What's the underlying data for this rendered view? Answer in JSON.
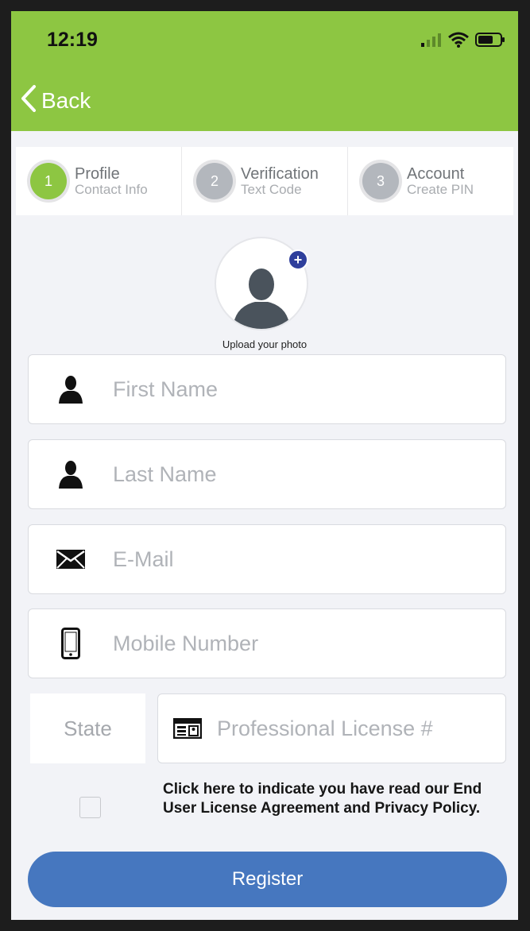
{
  "status_bar": {
    "time": "12:19"
  },
  "nav": {
    "back_label": "Back"
  },
  "stepper": [
    {
      "number": "1",
      "title": "Profile",
      "subtitle": "Contact Info",
      "active": true
    },
    {
      "number": "2",
      "title": "Verification",
      "subtitle": "Text Code",
      "active": false
    },
    {
      "number": "3",
      "title": "Account",
      "subtitle": "Create PIN",
      "active": false
    }
  ],
  "photo": {
    "plus": "+",
    "label": "Upload your photo"
  },
  "form": {
    "first_name_placeholder": "First Name",
    "last_name_placeholder": "Last Name",
    "email_placeholder": "E-Mail",
    "mobile_placeholder": "Mobile Number",
    "state_label": "State",
    "license_placeholder": "Professional License #"
  },
  "agreement": {
    "text": "Click here to indicate you have read our End User License Agreement and Privacy Policy."
  },
  "register_label": "Register",
  "colors": {
    "header": "#8dc642",
    "button": "#4677bf",
    "badge": "#2f3f9c"
  },
  "icons": {
    "back": "chevron-left-icon",
    "person": "person-icon",
    "email": "envelope-icon",
    "mobile": "phone-icon",
    "license": "id-card-icon"
  }
}
